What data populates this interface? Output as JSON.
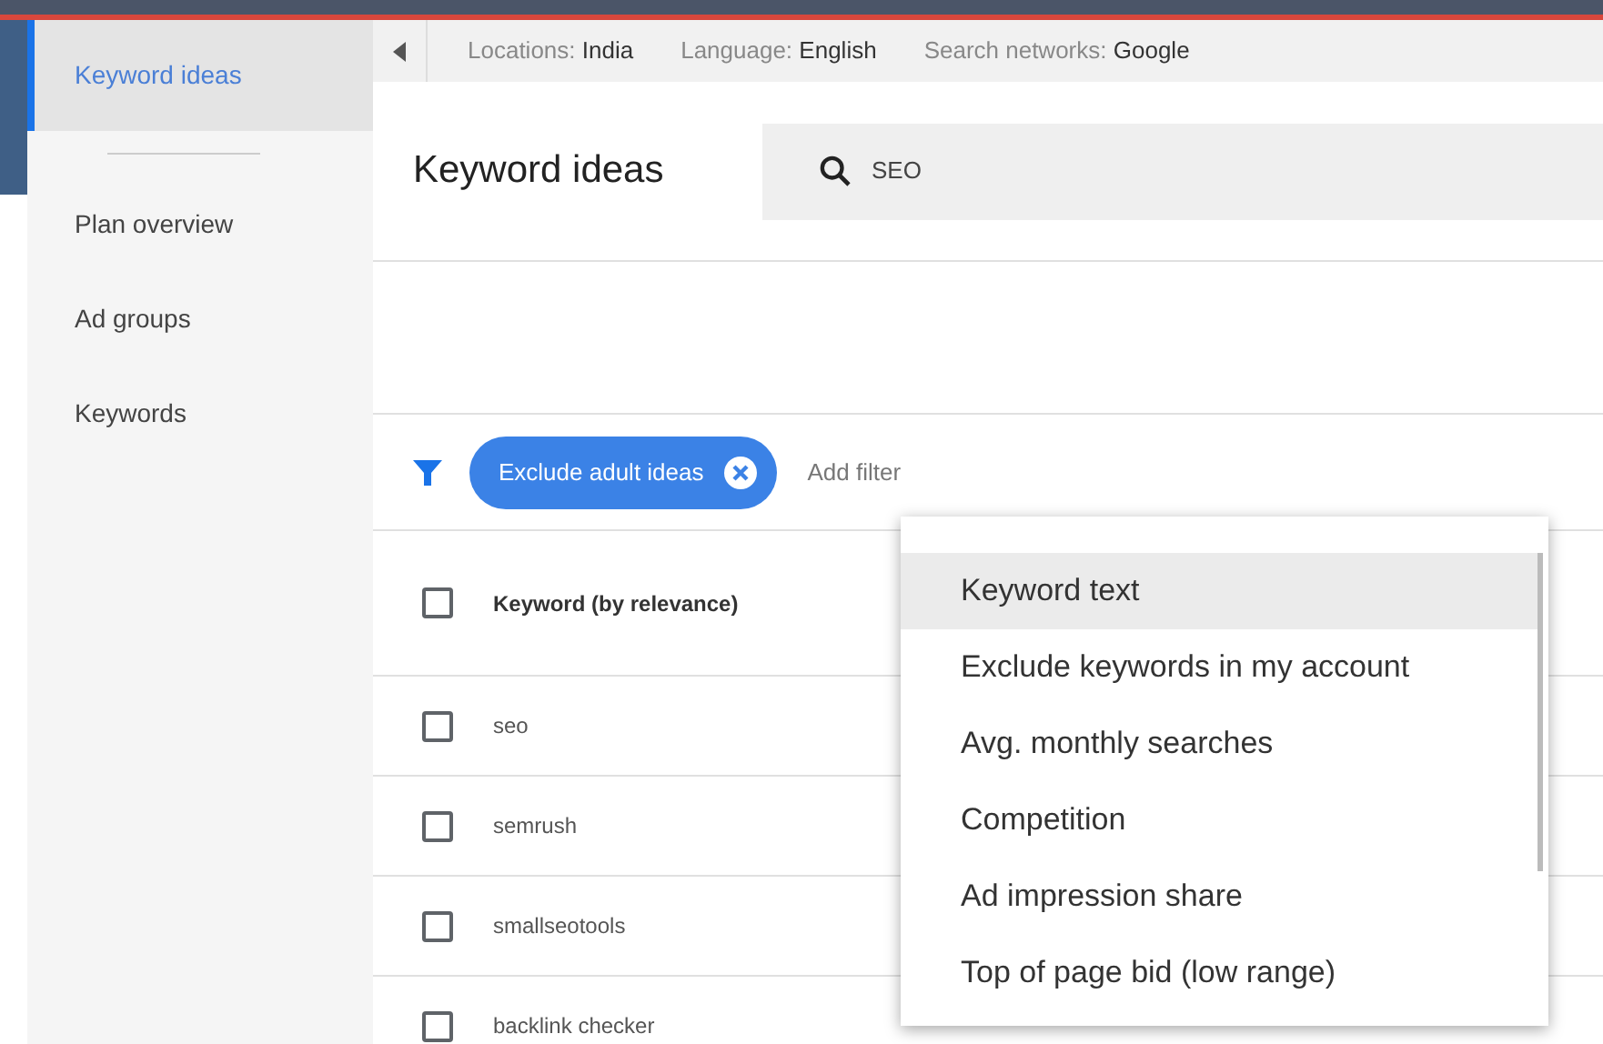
{
  "sidebar": {
    "items": [
      {
        "label": "Keyword ideas",
        "selected": true
      },
      {
        "label": "Plan overview",
        "selected": false
      },
      {
        "label": "Ad groups",
        "selected": false
      },
      {
        "label": "Keywords",
        "selected": false
      }
    ]
  },
  "settings_bar": [
    {
      "label": "Locations:",
      "value": "India"
    },
    {
      "label": "Language:",
      "value": "English"
    },
    {
      "label": "Search networks:",
      "value": "Google"
    }
  ],
  "title": "Keyword ideas",
  "search": {
    "value": "SEO"
  },
  "filters": {
    "chips": [
      "Exclude adult ideas"
    ],
    "add_filter": "Add filter"
  },
  "table": {
    "header": {
      "label": "Keyword (by relevance)",
      "checked": false
    },
    "rows": [
      {
        "keyword": "seo",
        "checked": false
      },
      {
        "keyword": "semrush",
        "checked": false
      },
      {
        "keyword": "smallseotools",
        "checked": false
      },
      {
        "keyword": "backlink checker",
        "checked": false
      }
    ]
  },
  "menu": {
    "items": [
      {
        "label": "Keyword text",
        "selected": true
      },
      {
        "label": "Exclude keywords in my account",
        "selected": false
      },
      {
        "label": "Avg. monthly searches",
        "selected": false
      },
      {
        "label": "Competition",
        "selected": false
      },
      {
        "label": "Ad impression share",
        "selected": false
      },
      {
        "label": "Top of page bid (low range)",
        "selected": false
      }
    ]
  }
}
